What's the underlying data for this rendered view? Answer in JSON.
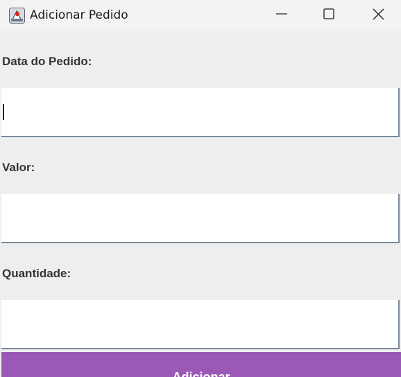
{
  "window": {
    "title": "Adicionar Pedido",
    "icon": "java-app-icon",
    "controls": {
      "minimize": "minimize-icon",
      "maximize": "maximize-icon",
      "close": "close-icon"
    }
  },
  "form": {
    "fields": [
      {
        "label": "Data do Pedido:",
        "value": ""
      },
      {
        "label": "Valor:",
        "value": ""
      },
      {
        "label": "Quantidade:",
        "value": ""
      }
    ],
    "submit_label": "Adicionar"
  },
  "colors": {
    "button_bg": "#9b59b6",
    "button_text": "#ffffff",
    "panel_bg": "#eeeeee",
    "label_text": "#333333"
  }
}
